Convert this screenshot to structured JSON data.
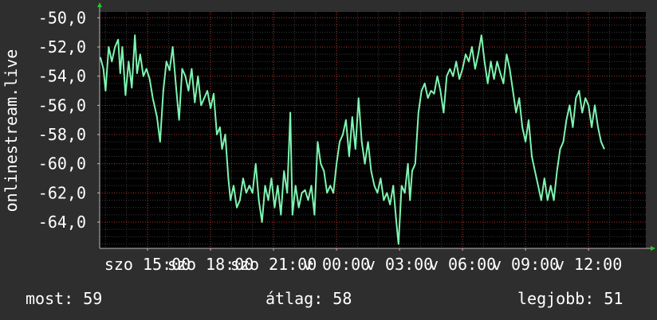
{
  "chart_data": {
    "type": "line",
    "ylabel": "onlinestream.live",
    "ylim": [
      -65.8,
      -49.6
    ],
    "y_ticks": [
      "-50,0",
      "-52,0",
      "-54,0",
      "-56,0",
      "-58,0",
      "-60,0",
      "-62,0",
      "-64,0"
    ],
    "y_tick_values": [
      -50,
      -52,
      -54,
      -56,
      -58,
      -60,
      -62,
      -64
    ],
    "x_ticks": [
      "szo 15:00",
      "szo 18:00",
      "szo 21:00",
      "v 00:00",
      "v 03:00",
      "v 06:00",
      "v 09:00",
      "v 12:00"
    ],
    "x_hours": [
      0,
      3,
      6,
      9,
      12,
      15,
      18,
      21
    ],
    "x_range_hours": [
      -2.28,
      23.73
    ],
    "grid": true,
    "line_color": "#7df5b0",
    "grid_color": "#c0392b",
    "series": [
      {
        "values": [
          [
            -2.25,
            -52.7
          ],
          [
            -2.1,
            -53.5
          ],
          [
            -2.0,
            -55.0
          ],
          [
            -1.85,
            -52.0
          ],
          [
            -1.7,
            -53.0
          ],
          [
            -1.55,
            -52.0
          ],
          [
            -1.4,
            -51.5
          ],
          [
            -1.3,
            -53.8
          ],
          [
            -1.2,
            -52.0
          ],
          [
            -1.05,
            -55.3
          ],
          [
            -0.9,
            -53.0
          ],
          [
            -0.75,
            -54.8
          ],
          [
            -0.6,
            -51.2
          ],
          [
            -0.5,
            -53.8
          ],
          [
            -0.35,
            -52.5
          ],
          [
            -0.2,
            -54.0
          ],
          [
            -0.05,
            -53.5
          ],
          [
            0.1,
            -54.2
          ],
          [
            0.25,
            -55.5
          ],
          [
            0.45,
            -56.8
          ],
          [
            0.6,
            -58.5
          ],
          [
            0.75,
            -55.0
          ],
          [
            0.9,
            -53.0
          ],
          [
            1.05,
            -53.6
          ],
          [
            1.2,
            -52.0
          ],
          [
            1.35,
            -54.6
          ],
          [
            1.5,
            -57.0
          ],
          [
            1.65,
            -53.5
          ],
          [
            1.8,
            -54.0
          ],
          [
            1.95,
            -55.0
          ],
          [
            2.1,
            -53.5
          ],
          [
            2.25,
            -55.8
          ],
          [
            2.4,
            -54.0
          ],
          [
            2.55,
            -56.0
          ],
          [
            2.7,
            -55.5
          ],
          [
            2.85,
            -55.0
          ],
          [
            3.0,
            -56.2
          ],
          [
            3.15,
            -55.2
          ],
          [
            3.3,
            -58.0
          ],
          [
            3.45,
            -57.5
          ],
          [
            3.55,
            -59.0
          ],
          [
            3.7,
            -58.0
          ],
          [
            3.85,
            -61.0
          ],
          [
            3.95,
            -62.5
          ],
          [
            4.1,
            -61.5
          ],
          [
            4.25,
            -63.0
          ],
          [
            4.4,
            -62.5
          ],
          [
            4.55,
            -61.0
          ],
          [
            4.7,
            -62.0
          ],
          [
            4.85,
            -61.5
          ],
          [
            5.0,
            -62.0
          ],
          [
            5.15,
            -60.0
          ],
          [
            5.3,
            -62.5
          ],
          [
            5.45,
            -64.0
          ],
          [
            5.6,
            -61.5
          ],
          [
            5.75,
            -62.5
          ],
          [
            5.9,
            -61.0
          ],
          [
            6.05,
            -63.0
          ],
          [
            6.2,
            -61.5
          ],
          [
            6.35,
            -63.5
          ],
          [
            6.5,
            -60.5
          ],
          [
            6.65,
            -62.0
          ],
          [
            6.8,
            -56.5
          ],
          [
            6.9,
            -63.5
          ],
          [
            7.05,
            -61.5
          ],
          [
            7.2,
            -63.0
          ],
          [
            7.35,
            -62.0
          ],
          [
            7.5,
            -61.8
          ],
          [
            7.65,
            -62.5
          ],
          [
            7.8,
            -61.5
          ],
          [
            7.95,
            -63.5
          ],
          [
            8.1,
            -58.5
          ],
          [
            8.25,
            -60.0
          ],
          [
            8.4,
            -60.5
          ],
          [
            8.55,
            -62.0
          ],
          [
            8.7,
            -61.5
          ],
          [
            8.85,
            -62.0
          ],
          [
            9.0,
            -60.0
          ],
          [
            9.15,
            -58.5
          ],
          [
            9.3,
            -58.0
          ],
          [
            9.45,
            -57.0
          ],
          [
            9.6,
            -59.5
          ],
          [
            9.75,
            -56.8
          ],
          [
            9.9,
            -59.0
          ],
          [
            10.05,
            -55.5
          ],
          [
            10.2,
            -58.5
          ],
          [
            10.35,
            -60.0
          ],
          [
            10.5,
            -58.5
          ],
          [
            10.65,
            -60.5
          ],
          [
            10.8,
            -61.5
          ],
          [
            10.95,
            -62.0
          ],
          [
            11.1,
            -61.0
          ],
          [
            11.25,
            -62.5
          ],
          [
            11.4,
            -62.0
          ],
          [
            11.55,
            -62.8
          ],
          [
            11.7,
            -61.5
          ],
          [
            11.85,
            -64.0
          ],
          [
            11.95,
            -65.5
          ],
          [
            12.1,
            -61.5
          ],
          [
            12.25,
            -62.0
          ],
          [
            12.4,
            -60.0
          ],
          [
            12.5,
            -62.5
          ],
          [
            12.6,
            -60.5
          ],
          [
            12.75,
            -60.0
          ],
          [
            12.9,
            -56.5
          ],
          [
            13.05,
            -55.0
          ],
          [
            13.2,
            -54.5
          ],
          [
            13.35,
            -55.5
          ],
          [
            13.5,
            -55.0
          ],
          [
            13.65,
            -55.2
          ],
          [
            13.8,
            -54.0
          ],
          [
            13.95,
            -55.0
          ],
          [
            14.1,
            -56.5
          ],
          [
            14.25,
            -54.0
          ],
          [
            14.4,
            -53.5
          ],
          [
            14.55,
            -54.0
          ],
          [
            14.7,
            -53.0
          ],
          [
            14.85,
            -54.2
          ],
          [
            15.0,
            -53.5
          ],
          [
            15.15,
            -52.5
          ],
          [
            15.3,
            -53.0
          ],
          [
            15.45,
            -52.0
          ],
          [
            15.6,
            -53.5
          ],
          [
            15.75,
            -52.5
          ],
          [
            15.9,
            -51.2
          ],
          [
            16.05,
            -53.0
          ],
          [
            16.2,
            -54.5
          ],
          [
            16.35,
            -53.0
          ],
          [
            16.5,
            -54.2
          ],
          [
            16.65,
            -53.0
          ],
          [
            16.8,
            -53.8
          ],
          [
            16.95,
            -54.5
          ],
          [
            17.1,
            -52.5
          ],
          [
            17.25,
            -53.5
          ],
          [
            17.4,
            -55.0
          ],
          [
            17.55,
            -56.5
          ],
          [
            17.7,
            -55.5
          ],
          [
            17.85,
            -57.5
          ],
          [
            18.0,
            -58.5
          ],
          [
            18.15,
            -57.0
          ],
          [
            18.3,
            -59.5
          ],
          [
            18.45,
            -60.5
          ],
          [
            18.6,
            -61.5
          ],
          [
            18.75,
            -62.5
          ],
          [
            18.9,
            -61.0
          ],
          [
            19.05,
            -62.5
          ],
          [
            19.2,
            -61.5
          ],
          [
            19.35,
            -62.5
          ],
          [
            19.5,
            -60.5
          ],
          [
            19.65,
            -59.0
          ],
          [
            19.8,
            -58.5
          ],
          [
            19.95,
            -57.0
          ],
          [
            20.1,
            -56.0
          ],
          [
            20.25,
            -57.5
          ],
          [
            20.4,
            -55.5
          ],
          [
            20.55,
            -55.0
          ],
          [
            20.7,
            -56.5
          ],
          [
            20.85,
            -55.5
          ],
          [
            21.0,
            -56.0
          ],
          [
            21.15,
            -57.5
          ],
          [
            21.3,
            -56.0
          ],
          [
            21.45,
            -57.5
          ],
          [
            21.6,
            -58.5
          ],
          [
            21.75,
            -59.0
          ]
        ]
      }
    ]
  },
  "stats": {
    "now": "most: 59",
    "avg": "átlag: 58",
    "best": "legjobb: 51"
  }
}
